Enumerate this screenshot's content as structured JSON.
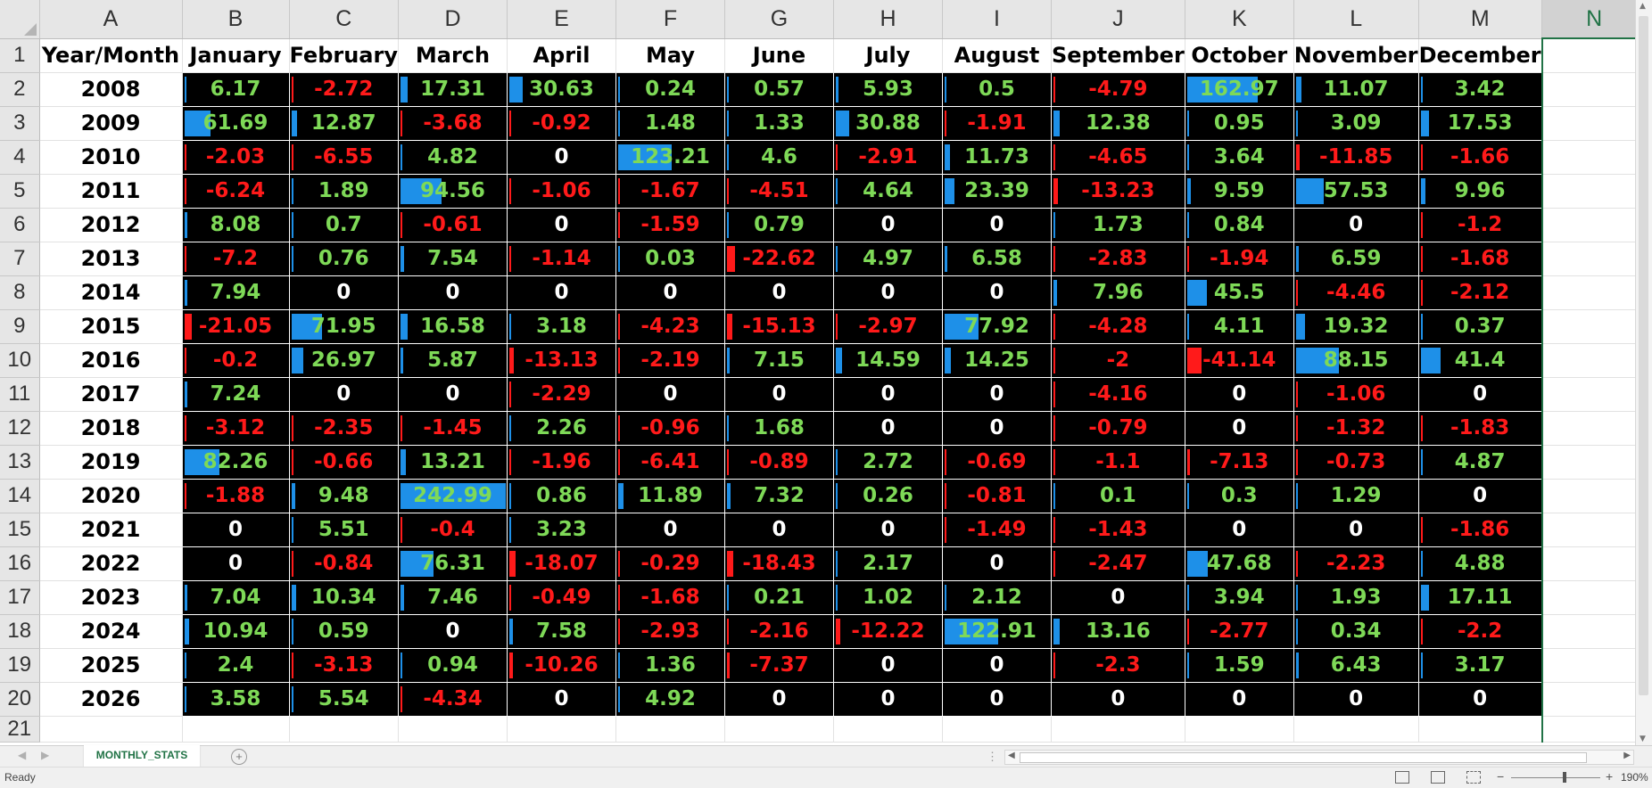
{
  "columns": [
    "A",
    "B",
    "C",
    "D",
    "E",
    "F",
    "G",
    "H",
    "I",
    "J",
    "K",
    "L",
    "M",
    "N"
  ],
  "selected_column": "N",
  "header_row": [
    "Year/Month",
    "January",
    "February",
    "March",
    "April",
    "May",
    "June",
    "July",
    "August",
    "September",
    "October",
    "November",
    "December"
  ],
  "rows": [
    {
      "num": "2",
      "year": "2008",
      "values": [
        6.17,
        -2.72,
        17.31,
        30.63,
        0.24,
        0.57,
        5.93,
        0.5,
        -4.79,
        162.97,
        11.07,
        3.42
      ]
    },
    {
      "num": "3",
      "year": "2009",
      "values": [
        61.69,
        12.87,
        -3.68,
        -0.92,
        1.48,
        1.33,
        30.88,
        -1.91,
        12.38,
        0.95,
        3.09,
        17.53
      ]
    },
    {
      "num": "4",
      "year": "2010",
      "values": [
        -2.03,
        -6.55,
        4.82,
        0,
        123.21,
        4.6,
        -2.91,
        11.73,
        -4.65,
        3.64,
        -11.85,
        -1.66
      ]
    },
    {
      "num": "5",
      "year": "2011",
      "values": [
        -6.24,
        1.89,
        94.56,
        -1.06,
        -1.67,
        -4.51,
        4.64,
        23.39,
        -13.23,
        9.59,
        57.53,
        9.96
      ]
    },
    {
      "num": "6",
      "year": "2012",
      "values": [
        8.08,
        0.7,
        -0.61,
        0,
        -1.59,
        0.79,
        0,
        0,
        1.73,
        0.84,
        0,
        -1.2
      ]
    },
    {
      "num": "7",
      "year": "2013",
      "values": [
        -7.2,
        0.76,
        7.54,
        -1.14,
        0.03,
        -22.62,
        4.97,
        6.58,
        -2.83,
        -1.94,
        6.59,
        -1.68
      ]
    },
    {
      "num": "8",
      "year": "2014",
      "values": [
        7.94,
        0,
        0,
        0,
        0,
        0,
        0,
        0,
        7.96,
        45.5,
        -4.46,
        -2.12
      ]
    },
    {
      "num": "9",
      "year": "2015",
      "values": [
        -21.05,
        71.95,
        16.58,
        3.18,
        -4.23,
        -15.13,
        -2.97,
        77.92,
        -4.28,
        4.11,
        19.32,
        0.37
      ]
    },
    {
      "num": "10",
      "year": "2016",
      "values": [
        -0.2,
        26.97,
        5.87,
        -13.13,
        -2.19,
        7.15,
        14.59,
        14.25,
        -2,
        -41.14,
        88.15,
        41.4
      ]
    },
    {
      "num": "11",
      "year": "2017",
      "values": [
        7.24,
        0,
        0,
        -2.29,
        0,
        0,
        0,
        0,
        -4.16,
        0,
        -1.06,
        0
      ]
    },
    {
      "num": "12",
      "year": "2018",
      "values": [
        -3.12,
        -2.35,
        -1.45,
        2.26,
        -0.96,
        1.68,
        0,
        0,
        -0.79,
        0,
        -1.32,
        -1.83
      ]
    },
    {
      "num": "13",
      "year": "2019",
      "values": [
        82.26,
        -0.66,
        13.21,
        -1.96,
        -6.41,
        -0.89,
        2.72,
        -0.69,
        -1.1,
        -7.13,
        -0.73,
        4.87
      ]
    },
    {
      "num": "14",
      "year": "2020",
      "values": [
        -1.88,
        9.48,
        242.99,
        0.86,
        11.89,
        7.32,
        0.26,
        -0.81,
        0.1,
        0.3,
        1.29,
        0
      ]
    },
    {
      "num": "15",
      "year": "2021",
      "values": [
        0,
        5.51,
        -0.4,
        3.23,
        0,
        0,
        0,
        -1.49,
        -1.43,
        0,
        0,
        -1.86
      ]
    },
    {
      "num": "16",
      "year": "2022",
      "values": [
        0,
        -0.84,
        76.31,
        -18.07,
        -0.29,
        -18.43,
        2.17,
        0,
        -2.47,
        47.68,
        -2.23,
        4.88
      ]
    },
    {
      "num": "17",
      "year": "2023",
      "values": [
        7.04,
        10.34,
        7.46,
        -0.49,
        -1.68,
        0.21,
        1.02,
        2.12,
        0,
        3.94,
        1.93,
        17.11
      ]
    },
    {
      "num": "18",
      "year": "2024",
      "values": [
        10.94,
        0.59,
        0,
        7.58,
        -2.93,
        -2.16,
        -12.22,
        122.91,
        13.16,
        -2.77,
        0.34,
        -2.2
      ]
    },
    {
      "num": "19",
      "year": "2025",
      "values": [
        2.4,
        -3.13,
        0.94,
        -10.26,
        1.36,
        -7.37,
        0,
        0,
        -2.3,
        1.59,
        6.43,
        3.17
      ]
    },
    {
      "num": "20",
      "year": "2026",
      "values": [
        3.58,
        5.54,
        -4.34,
        0,
        4.92,
        0,
        0,
        0,
        0,
        0,
        0,
        0
      ]
    }
  ],
  "partial_row_num": "21",
  "header_row_num": "1",
  "databar_scale": {
    "max_positive": 242.99,
    "max_negative": 41.14
  },
  "colors": {
    "positive_text": "#7ed957",
    "negative_text": "#ff1a1a",
    "zero_text": "#ffffff",
    "positive_bar": "#1e90e8",
    "negative_bar": "#ff1a1a",
    "accent": "#217346"
  },
  "sheet_tab": "MONTHLY_STATS",
  "add_sheet_icon": "plus-circle-icon",
  "status": "Ready",
  "zoom_level": "190%"
}
